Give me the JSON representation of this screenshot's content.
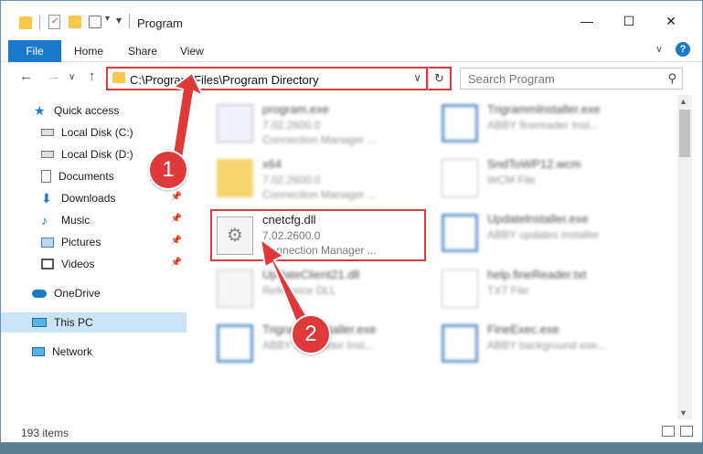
{
  "window": {
    "title": "Program",
    "controls": {
      "minimize": "—",
      "maximize": "☐",
      "close": "✕"
    }
  },
  "ribbon": {
    "file": "File",
    "tabs": [
      "Home",
      "Share",
      "View"
    ],
    "help": "?"
  },
  "address": {
    "path": "C:\\Program Files\\Program Directory",
    "search_placeholder": "Search Program"
  },
  "nav": {
    "items": [
      {
        "label": "Quick access",
        "icon": "star-icon"
      },
      {
        "label": "Local Disk (C:)",
        "icon": "drive-icon"
      },
      {
        "label": "Local Disk (D:)",
        "icon": "drive-icon"
      },
      {
        "label": "Documents",
        "icon": "documents-icon"
      },
      {
        "label": "Downloads",
        "icon": "download-icon"
      },
      {
        "label": "Music",
        "icon": "music-icon"
      },
      {
        "label": "Pictures",
        "icon": "pictures-icon"
      },
      {
        "label": "Videos",
        "icon": "videos-icon"
      },
      {
        "label": "OneDrive",
        "icon": "cloud-icon"
      },
      {
        "label": "This PC",
        "icon": "pc-icon"
      },
      {
        "label": "Network",
        "icon": "network-icon"
      }
    ]
  },
  "files": [
    {
      "name": "program.exe",
      "version": "7.02.2600.0",
      "description": "Connection Manager ..."
    },
    {
      "name": "Trigrammlnstaller.exe",
      "version": "ABBY finereader Inst...",
      "description": ""
    },
    {
      "name": "x64",
      "version": "7.02.2600.0",
      "description": "Connection Manager ..."
    },
    {
      "name": "SndToWP12.wcm",
      "version": "WCM File",
      "description": ""
    },
    {
      "name": "cnetcfg.dll",
      "version": "7.02.2600.0",
      "description": "Connection Manager ..."
    },
    {
      "name": "Updatelnstaller.exe",
      "version": "ABBY updates installer",
      "description": ""
    },
    {
      "name": "UpdateClient21.dll",
      "version": "Reference DLL",
      "description": ""
    },
    {
      "name": "help.fineReader.txt",
      "version": "TXT File",
      "description": ""
    },
    {
      "name": "TrigrammInstaller.exe",
      "version": "ABBY finereader Inst...",
      "description": ""
    },
    {
      "name": "FineExec.exe",
      "version": "ABBY background exe...",
      "description": ""
    }
  ],
  "status": {
    "items": "193 items"
  },
  "callouts": [
    "1",
    "2"
  ],
  "colors": {
    "accent": "#1979ca",
    "highlight": "#e0393a",
    "selected": "#cce4f7"
  }
}
